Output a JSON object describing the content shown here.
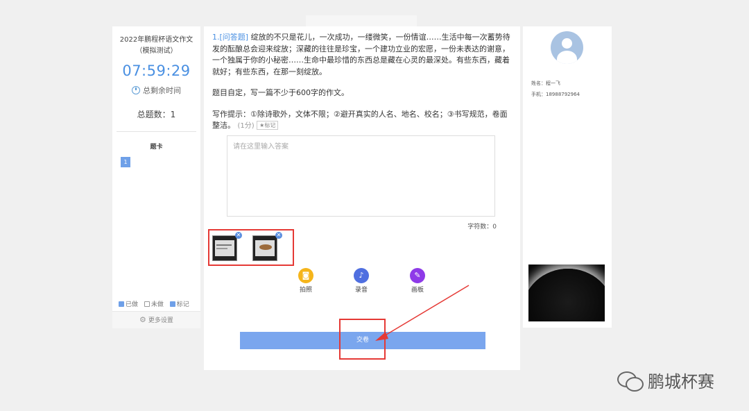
{
  "left_panel": {
    "exam_title": "2022年鹏程杯语文作文（模拟测试）",
    "timer": "07:59:29",
    "remaining_label": "总剩余时间",
    "total_label": "总题数：1",
    "card_title": "题卡",
    "card_items": [
      "1"
    ],
    "legend": {
      "done": "已做",
      "todo": "未做",
      "marked": "标记"
    },
    "more_settings": "更多设置"
  },
  "question": {
    "number": "1.",
    "type": "[问答题]",
    "paragraph1": "绽放的不只是花儿，一次成功，一缕微笑，一份情谊……生活中每一次蓄势待发的酝酿总会迎来绽放；深藏的往往是珍宝，一个建功立业的宏愿，一份未表达的谢意，一个独属于你的小秘密……生命中最珍惜的东西总是藏在心灵的最深处。有些东西，藏着就好；有些东西，在那一刻绽放。",
    "paragraph2": "题目自定，写一篇不少于600字的作文。",
    "paragraph3": "写作提示：①除诗歌外，文体不限；②避开真实的人名、地名、校名；③书写规范，卷面整洁。",
    "score": "(1分)",
    "mark_label": "★标记"
  },
  "answer": {
    "placeholder": "请在这里输入答案",
    "char_count_label": "字符数：0"
  },
  "tools": {
    "photo": "拍照",
    "record": "录音",
    "board": "画板"
  },
  "submit_label": "交卷",
  "right_panel": {
    "name_label": "姓名：",
    "name": "程一飞",
    "phone_label": "手机：",
    "phone": "18988792964"
  },
  "watermark": "鹏城杯赛",
  "colors": {
    "accent": "#4a90e2",
    "submit": "#7aa6ee",
    "highlight": "#e53935",
    "photo_tool": "#f5b51b",
    "record_tool": "#4f6fe0",
    "board_tool": "#8e3ae8"
  }
}
